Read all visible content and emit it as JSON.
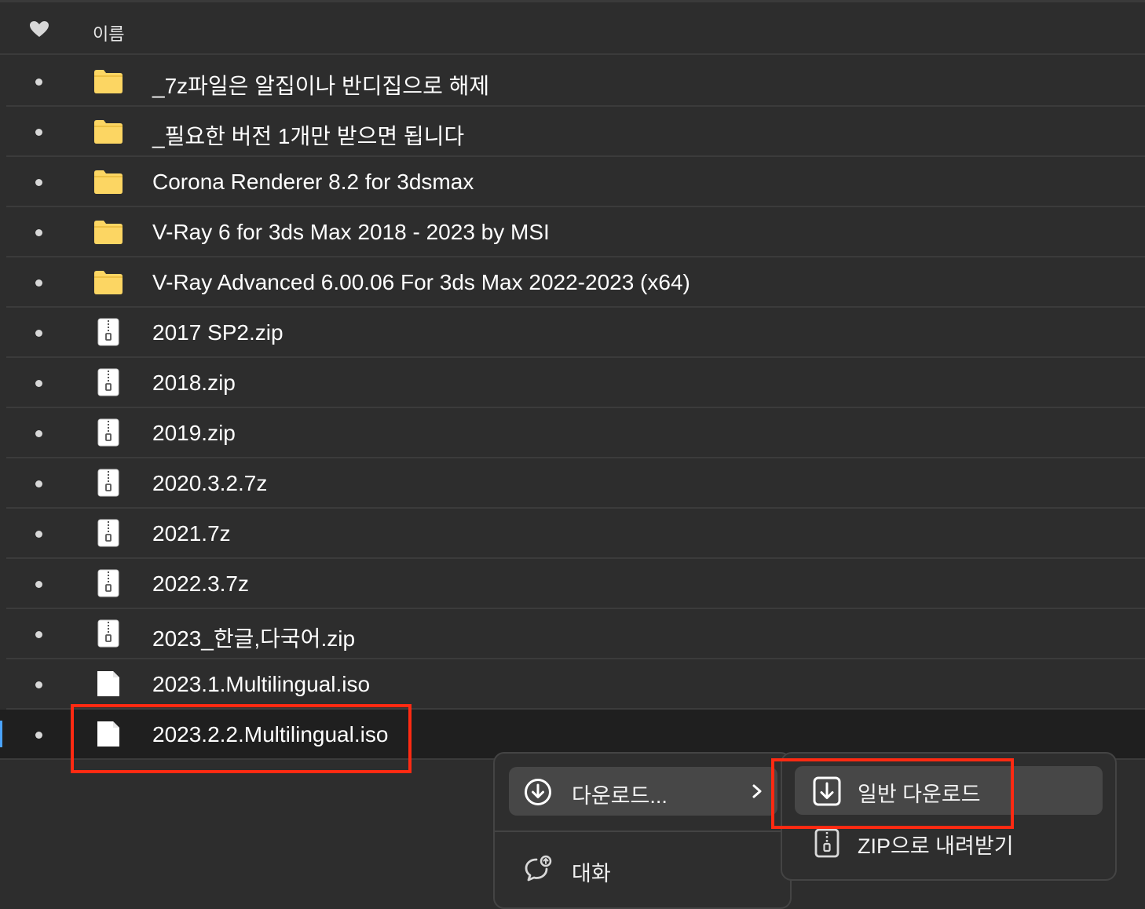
{
  "header": {
    "heart_icon": "heart-icon",
    "name_column": "이름"
  },
  "files": [
    {
      "name": "_7z파일은 알집이나 반디집으로 해제",
      "type": "folder"
    },
    {
      "name": "_필요한 버전 1개만 받으면 됩니다",
      "type": "folder"
    },
    {
      "name": "Corona Renderer 8.2 for 3dsmax",
      "type": "folder"
    },
    {
      "name": "V-Ray 6 for 3ds Max 2018 - 2023 by MSI",
      "type": "folder"
    },
    {
      "name": "V-Ray Advanced 6.00.06 For 3ds Max 2022-2023 (x64)",
      "type": "folder"
    },
    {
      "name": "2017 SP2.zip",
      "type": "archive"
    },
    {
      "name": "2018.zip",
      "type": "archive"
    },
    {
      "name": "2019.zip",
      "type": "archive"
    },
    {
      "name": "2020.3.2.7z",
      "type": "archive"
    },
    {
      "name": "2021.7z",
      "type": "archive"
    },
    {
      "name": "2022.3.7z",
      "type": "archive"
    },
    {
      "name": "2023_한글,다국어.zip",
      "type": "archive"
    },
    {
      "name": "2023.1.Multilingual.iso",
      "type": "file"
    },
    {
      "name": "2023.2.2.Multilingual.iso",
      "type": "file",
      "selected": true
    }
  ],
  "context_menu": {
    "download": {
      "label": "다운로드...",
      "icon": "download-circle-icon"
    },
    "chat": {
      "label": "대화",
      "icon": "chat-icon"
    }
  },
  "submenu": {
    "normal_download": {
      "label": "일반 다운로드",
      "icon": "download-box-icon"
    },
    "zip_download": {
      "label": "ZIP으로 내려받기",
      "icon": "zip-file-icon"
    }
  },
  "colors": {
    "background": "#2d2d2d",
    "selected_row": "#1f1f1f",
    "highlight_box": "#ff2a12",
    "folder": "#fcd663",
    "selection_accent": "#4aa3ff"
  }
}
